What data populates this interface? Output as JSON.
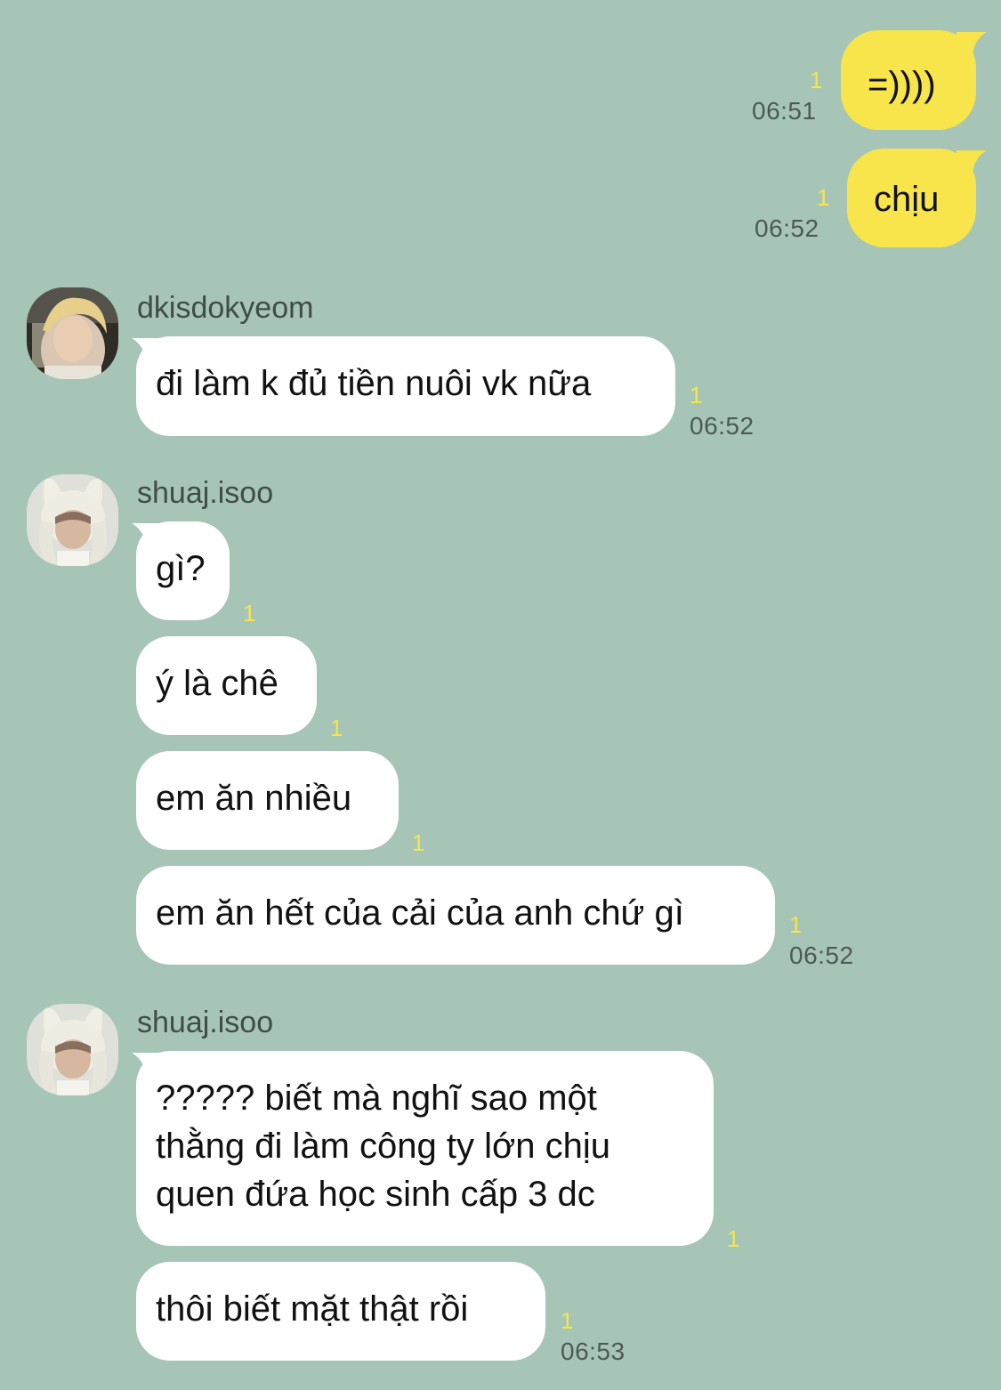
{
  "colors": {
    "background": "#a7c5b6",
    "outgoing_bubble": "#f8e54b",
    "incoming_bubble": "#ffffff",
    "unread_count": "#f7e54a",
    "meta_text": "#4b5a54"
  },
  "outgoing": [
    {
      "text": "=))))",
      "unread": "1",
      "time": "06:51"
    },
    {
      "text": "chịu",
      "unread": "1",
      "time": "06:52"
    }
  ],
  "groups": [
    {
      "sender": "dkisdokyeom",
      "avatar_icon": "profile-photo-blond-icon",
      "messages": [
        {
          "text": "đi làm k đủ tiền nuôi vk nữa",
          "unread": "1",
          "time": "06:52"
        }
      ]
    },
    {
      "sender": "shuaj.isoo",
      "avatar_icon": "profile-photo-bunny-hat-icon",
      "messages": [
        {
          "text": "gì?",
          "unread": "1"
        },
        {
          "text": "ý là chê",
          "unread": "1"
        },
        {
          "text": "em ăn nhiều",
          "unread": "1"
        },
        {
          "text": "em ăn hết của cải của anh chứ gì",
          "unread": "1",
          "time": "06:52"
        }
      ]
    },
    {
      "sender": "shuaj.isoo",
      "avatar_icon": "profile-photo-bunny-hat-icon",
      "messages": [
        {
          "text": "????? biết mà nghĩ sao một\nthằng đi làm công ty lớn chịu\nquen đứa học sinh cấp 3 dc",
          "unread": "1"
        },
        {
          "text": "thôi biết mặt thật rồi",
          "unread": "1",
          "time": "06:53"
        }
      ]
    }
  ]
}
